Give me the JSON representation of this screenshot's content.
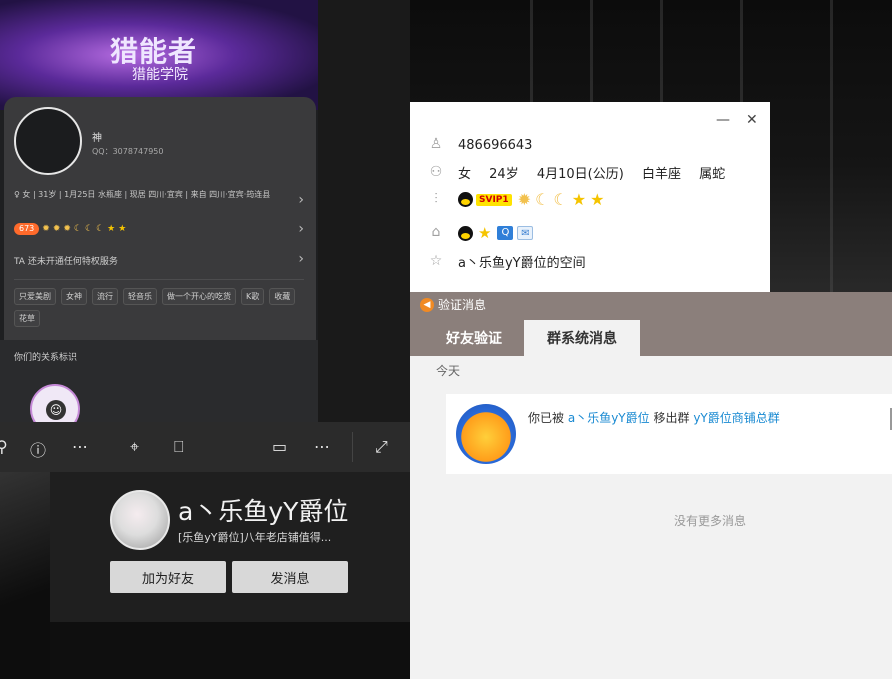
{
  "profile_left": {
    "banner_title": "猎能者",
    "banner_subtitle": "猎能学院",
    "name": "神",
    "qq": "QQ：3078747950",
    "info": "♀ 女 | 31岁 | 1月25日 水瓶座 | 现居 四川·宜宾 | 来自 四川·宜宾·筠连县",
    "level": "673",
    "privilege": "TA 还未开通任何特权服务",
    "tags": [
      "只爱美剧",
      "女神",
      "流行",
      "轻音乐",
      "做一个开心的吃货",
      "K歌",
      "收藏",
      "花草"
    ],
    "relation_title": "你们的关系标识"
  },
  "toolbar": {
    "icons": [
      "zoom-icon",
      "info-icon",
      "more-icon",
      "scan-icon",
      "ocr-icon",
      "fit-icon",
      "more2-icon",
      "expand-icon"
    ]
  },
  "friend_card": {
    "name": "a丶乐鱼yY爵位",
    "signature": "[乐鱼yY爵位]八年老店铺值得...",
    "add_button": "加为好友",
    "message_button": "发消息"
  },
  "details": {
    "qq_number": "486696643",
    "gender": "女",
    "age": "24岁",
    "birthday": "4月10日(公历)",
    "zodiac": "白羊座",
    "chinese_zodiac": "属蛇",
    "vip_label": "SVIP1",
    "space_link": "a丶乐鱼yY爵位的空间"
  },
  "verify": {
    "title": "验证消息",
    "tabs": [
      "好友验证",
      "群系统消息"
    ],
    "active_tab": 1,
    "today": "今天",
    "message_prefix": "你已被",
    "message_user": "a丶乐鱼yY爵位",
    "message_mid": "移出群",
    "message_group": "yY爵位商铺总群",
    "no_more": "没有更多消息"
  }
}
